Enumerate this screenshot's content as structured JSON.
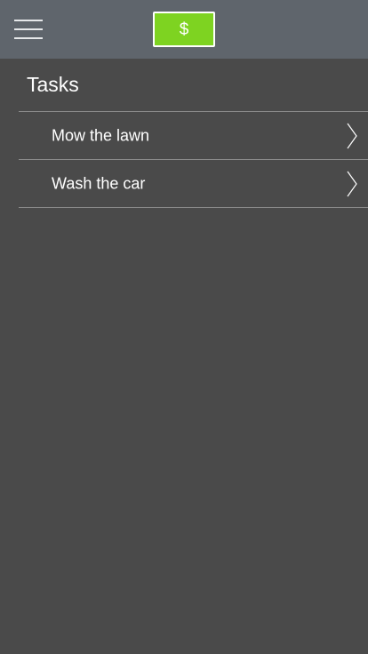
{
  "header": {
    "menu_icon": "hamburger-menu-icon",
    "money_button_label": "$",
    "money_button_color": "#7ed321",
    "bar_color": "#5f656c"
  },
  "tasks": {
    "title": "Tasks",
    "items": [
      {
        "label": "Mow the lawn",
        "icon": "chevron-right-icon"
      },
      {
        "label": "Wash the car",
        "icon": "chevron-right-icon"
      }
    ]
  },
  "colors": {
    "background": "#4a4a4a",
    "divider": "#8a8a8a",
    "text": "#ffffff"
  }
}
